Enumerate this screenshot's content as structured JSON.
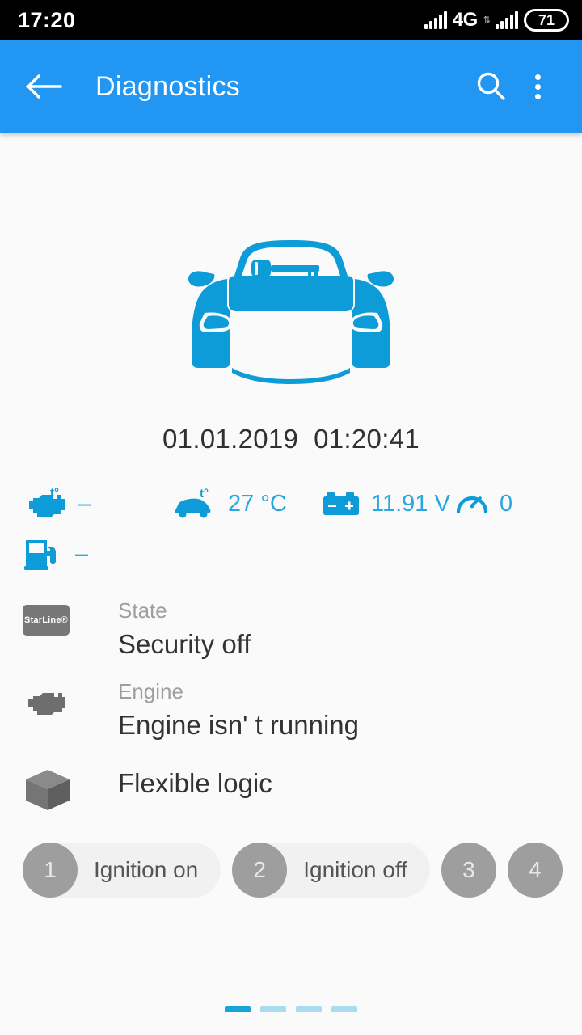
{
  "status_bar": {
    "clock": "17:20",
    "network_label": "4G",
    "data_arrows": "⇅",
    "battery_level": "71",
    "signal_icon": "signal-bars-icon",
    "signal_icon_2": "signal-bars-icon"
  },
  "app_bar": {
    "back_icon": "back-arrow-icon",
    "title": "Diagnostics",
    "search_icon": "search-icon",
    "overflow_icon": "overflow-menu-icon"
  },
  "vehicle": {
    "image_name": "car-front-with-key-icon",
    "timestamp": "01.01.2019  01:20:41"
  },
  "metrics": [
    {
      "icon": "engine-temperature-icon",
      "value": "–",
      "name": "engine-temperature"
    },
    {
      "icon": "cabin-temperature-icon",
      "value": "27 °C",
      "name": "cabin-temperature"
    },
    {
      "icon": "battery-voltage-icon",
      "value": "11.91 V",
      "name": "battery-voltage"
    },
    {
      "icon": "speedometer-icon",
      "value": "0",
      "name": "speed"
    },
    {
      "icon": "fuel-level-icon",
      "value": "–",
      "name": "fuel-level"
    }
  ],
  "info_rows": [
    {
      "icon": "starline-logo-icon",
      "badge_text": "StarLine®",
      "label": "State",
      "value": "Security off"
    },
    {
      "icon": "engine-icon",
      "label": "Engine",
      "value": "Engine isn' t running"
    }
  ],
  "flexible_logic": {
    "icon": "cube-icon",
    "title": "Flexible logic",
    "chips": [
      {
        "number": "1",
        "label": "Ignition on"
      },
      {
        "number": "2",
        "label": "Ignition off"
      },
      {
        "number": "3",
        "label": ""
      },
      {
        "number": "4",
        "label": ""
      }
    ]
  },
  "page_indicator": {
    "count": 4,
    "active_index": 0
  },
  "colors": {
    "app_bar": "#2196f3",
    "accent": "#29a7df",
    "car": "#0d9cd8",
    "page_dot_active": "#1aa3d9",
    "page_dot_inactive": "#a9dcef",
    "chip_bg": "#f1f1f1",
    "chip_badge": "#9e9e9e"
  }
}
